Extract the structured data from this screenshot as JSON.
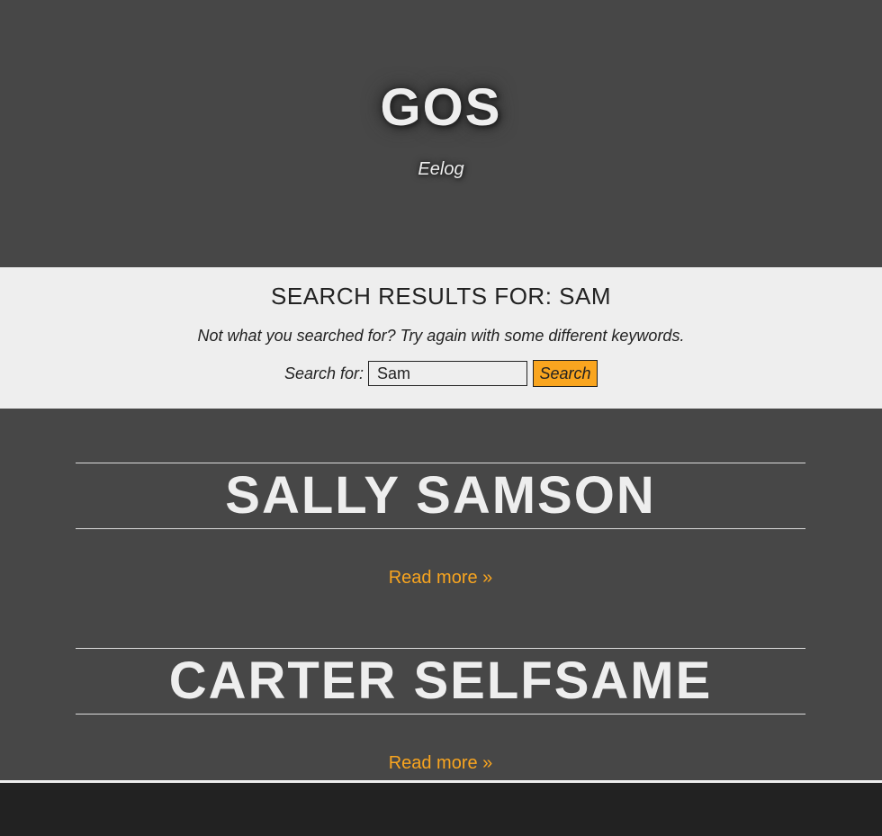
{
  "header": {
    "site_title": "GOS",
    "tagline": "Eelog"
  },
  "search": {
    "title": "SEARCH RESULTS FOR: SAM",
    "hint": "Not what you searched for? Try again with some different keywords.",
    "label": "Search for:",
    "input_value": "Sam",
    "button_label": "Search"
  },
  "results": [
    {
      "title": "SALLY SAMSON",
      "read_more": "Read more »"
    },
    {
      "title": "CARTER SELFSAME",
      "read_more": "Read more »"
    }
  ],
  "colors": {
    "background": "#474747",
    "panel": "#eeeeee",
    "accent": "#f9a51f",
    "footer": "#222222"
  }
}
